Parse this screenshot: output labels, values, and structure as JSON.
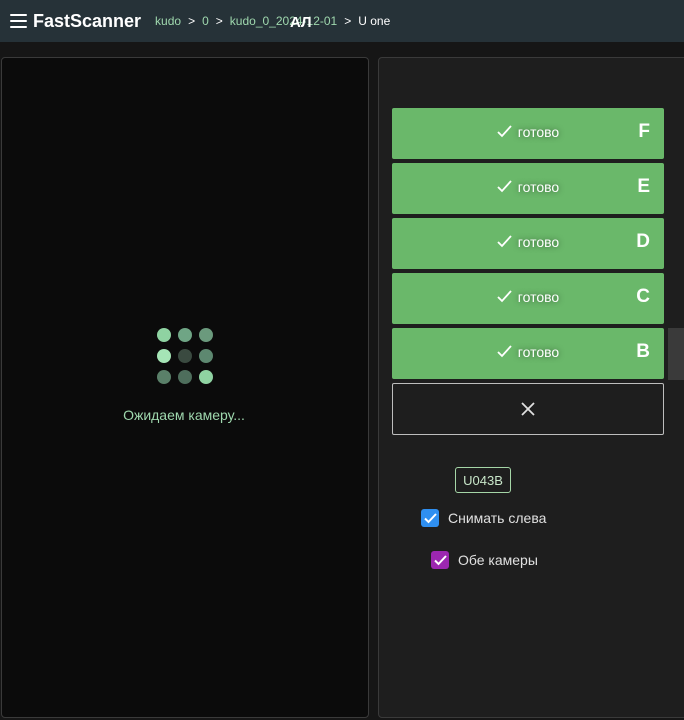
{
  "header": {
    "menu_icon": "hamburger-icon",
    "app_title": "FastScanner",
    "breadcrumbs": [
      "kudo",
      "0",
      "kudo_0_2024-12-01",
      "U one"
    ],
    "separator": ">"
  },
  "camera": {
    "status_text": "Ожидаем камеру...",
    "loader_icon": "dots-grid-loader-icon"
  },
  "panel": {
    "title": "АЛ",
    "sections": [
      {
        "status": "готово",
        "letter": "F"
      },
      {
        "status": "готово",
        "letter": "E"
      },
      {
        "status": "готово",
        "letter": "D"
      },
      {
        "status": "готово",
        "letter": "C"
      },
      {
        "status": "готово",
        "letter": "B"
      }
    ],
    "close_icon": "close-icon",
    "id_badge": "U043B",
    "options": [
      {
        "label": "Снимать слева",
        "checked": true,
        "color": "#2f8ff0"
      },
      {
        "label": "Обе камеры",
        "checked": true,
        "color": "#9c27b0"
      }
    ]
  },
  "colors": {
    "header_bg": "#263238",
    "accent_green": "#6ab86a",
    "breadcrumb_green": "#9fd8ae",
    "camera_bg": "#0b0b0b",
    "panel_bg": "#1e1e1e"
  }
}
